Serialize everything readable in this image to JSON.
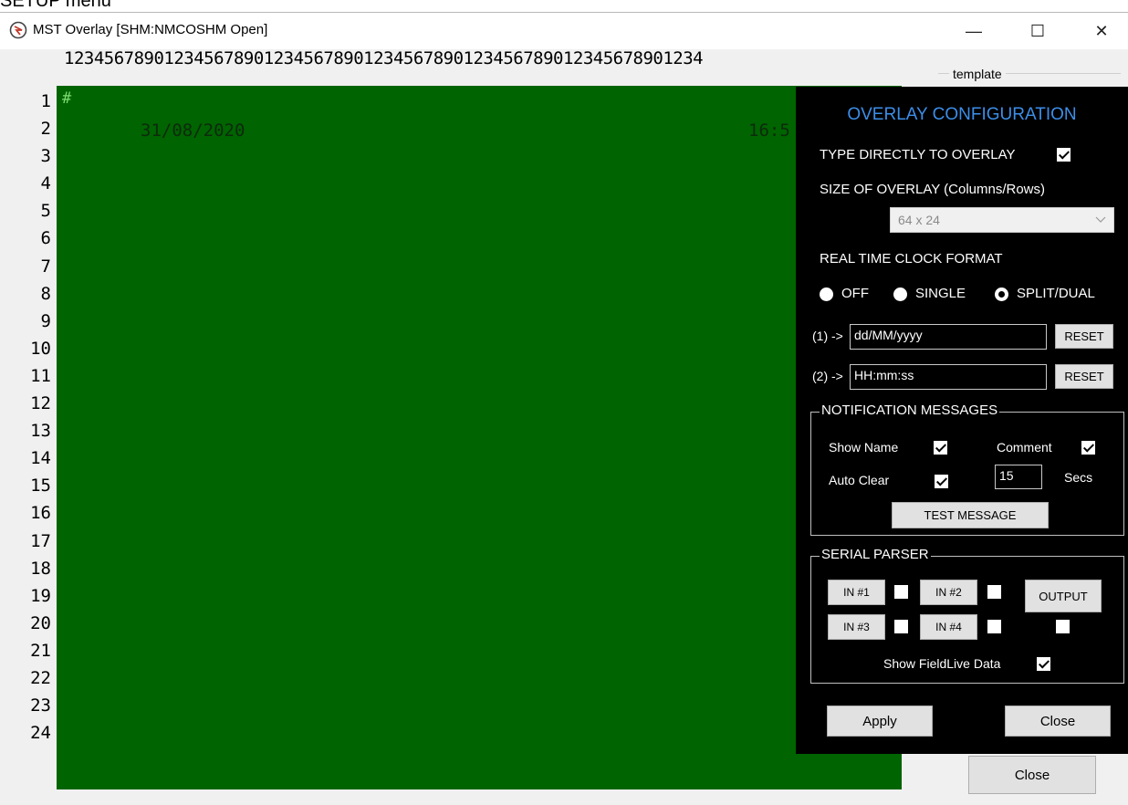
{
  "caption": "SETUP menu",
  "window": {
    "title": "MST Overlay  [SHM:NMCOSHM Open]",
    "minimize": "—",
    "maximize": "☐",
    "close": "✕"
  },
  "column_ruler": "1234567890123456789012345678901234567890123456789012345678901234",
  "template_label": "template",
  "row_numbers": [
    "1",
    "2",
    "3",
    "4",
    "5",
    "6",
    "7",
    "8",
    "9",
    "10",
    "11",
    "12",
    "13",
    "14",
    "15",
    "16",
    "17",
    "18",
    "19",
    "20",
    "21",
    "22",
    "23",
    "24"
  ],
  "screen": {
    "cursor": "#",
    "date": "31/08/2020",
    "time_partial": "16:5"
  },
  "main_close_label": "Close",
  "overlay_panel": {
    "title": "OVERLAY CONFIGURATION",
    "type_directly_label": "TYPE DIRECTLY TO OVERLAY",
    "type_directly_checked": true,
    "size_label": "SIZE OF OVERLAY (Columns/Rows)",
    "size_value": "64 x 24",
    "clock_label": "REAL TIME CLOCK FORMAT",
    "clock_options": [
      "OFF",
      "SINGLE",
      "SPLIT/DUAL"
    ],
    "clock_selected": "SPLIT/DUAL",
    "format1_label": "(1) ->",
    "format1_value": "dd/MM/yyyy",
    "format2_label": "(2) ->",
    "format2_value": "HH:mm:ss",
    "reset_label": "RESET",
    "notification_title": "NOTIFICATION MESSAGES",
    "show_name_label": "Show Name",
    "comment_label": "Comment",
    "auto_clear_label": "Auto Clear",
    "auto_clear_secs": "15",
    "secs_label": "Secs",
    "test_message_label": "TEST MESSAGE",
    "serial_title": "SERIAL PARSER",
    "in1": "IN #1",
    "in2": "IN #2",
    "in3": "IN #3",
    "in4": "IN #4",
    "output_label": "OUTPUT",
    "show_fieldlive_label": "Show FieldLive Data",
    "apply_label": "Apply",
    "close_label": "Close",
    "accent_color": "#3c8ee8"
  }
}
